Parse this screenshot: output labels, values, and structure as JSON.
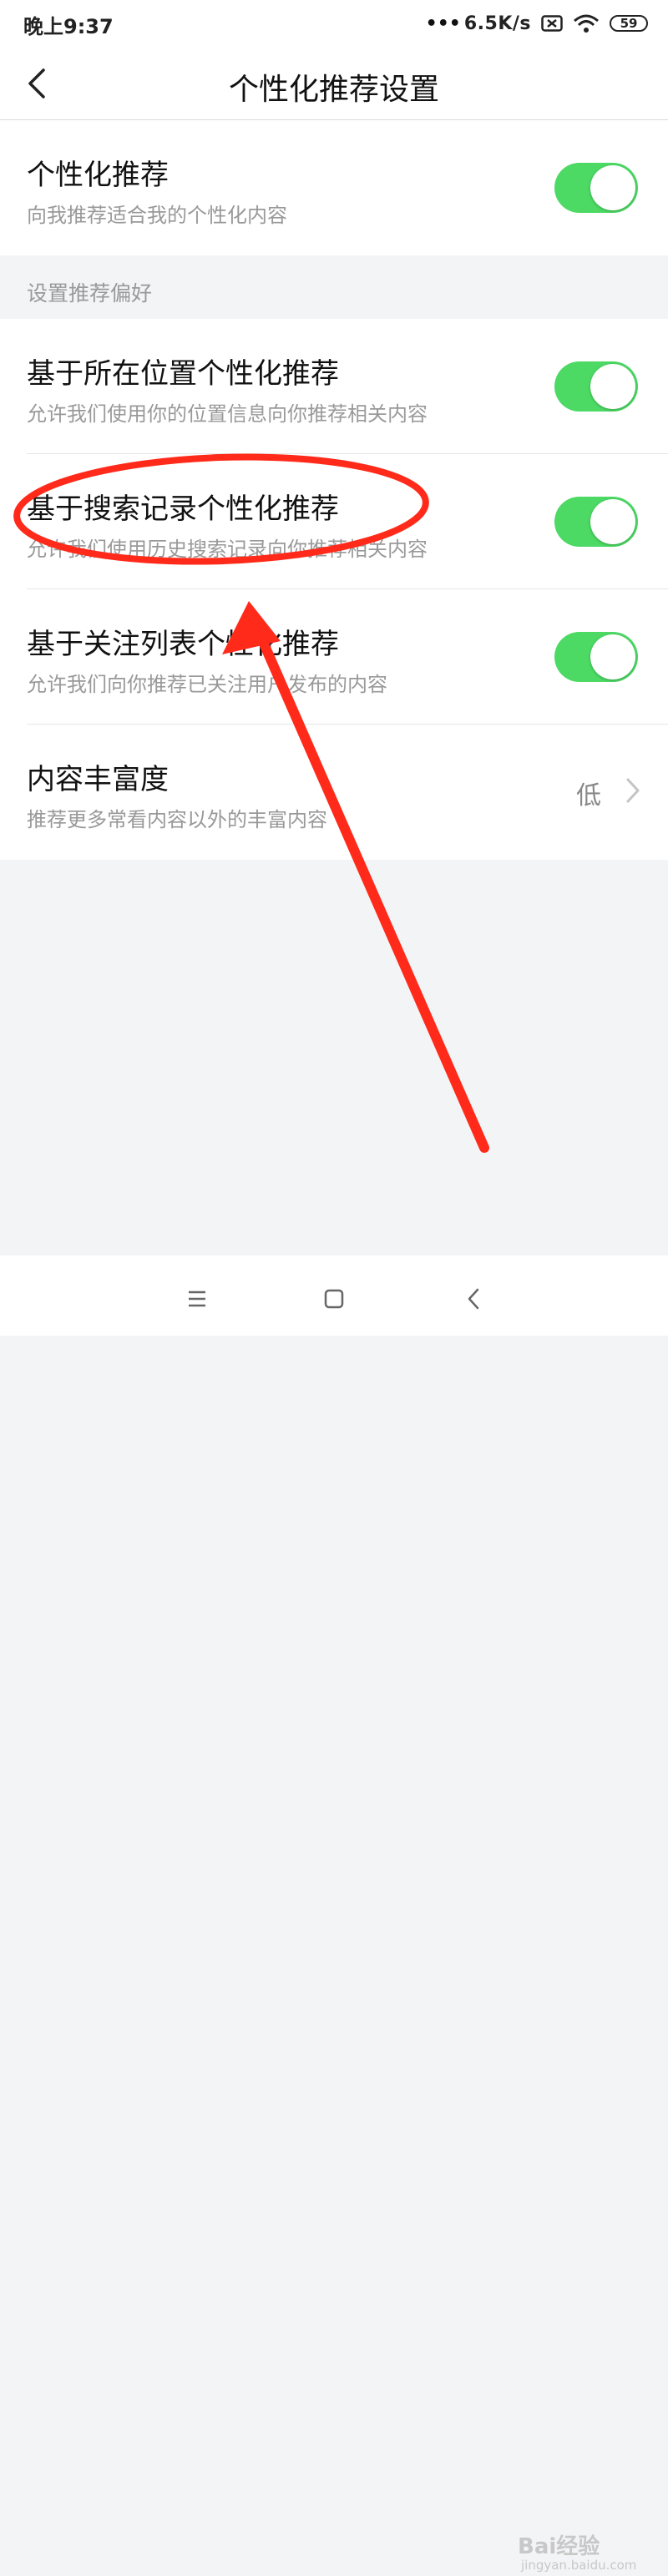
{
  "status_bar": {
    "time": "晚上9:37",
    "speed": "6.5K/s",
    "battery": "59"
  },
  "header": {
    "title": "个性化推荐设置"
  },
  "main_setting": {
    "title": "个性化推荐",
    "subtitle": "向我推荐适合我的个性化内容",
    "enabled": true
  },
  "section": {
    "label": "设置推荐偏好"
  },
  "preferences": [
    {
      "title": "基于所在位置个性化推荐",
      "subtitle": "允许我们使用你的位置信息向你推荐相关内容",
      "enabled": true
    },
    {
      "title": "基于搜索记录个性化推荐",
      "subtitle": "允许我们使用历史搜索记录向你推荐相关内容",
      "enabled": true
    },
    {
      "title": "基于关注列表个性化推荐",
      "subtitle": "允许我们向你推荐已关注用户发布的内容",
      "enabled": true
    }
  ],
  "richness": {
    "title": "内容丰富度",
    "subtitle": "推荐更多常看内容以外的丰富内容",
    "value": "低"
  },
  "watermark": {
    "brand": "Bai经验",
    "url": "jingyan.baidu.com"
  },
  "colors": {
    "toggle_on": "#4cd964",
    "annotation": "#ff2a1a"
  }
}
